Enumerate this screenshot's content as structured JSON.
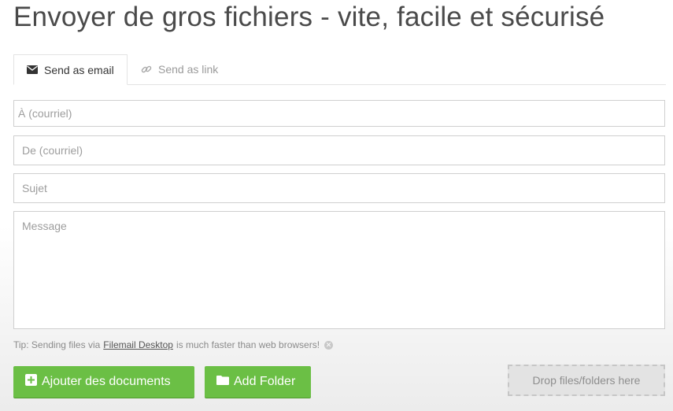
{
  "header": {
    "title": "Envoyer de gros fichiers - vite, facile et sécurisé"
  },
  "tabs": [
    {
      "label": "Send as email",
      "icon": "envelope-icon",
      "active": true
    },
    {
      "label": "Send as link",
      "icon": "link-icon",
      "active": false
    }
  ],
  "form": {
    "to_placeholder": "À (courriel)",
    "from_placeholder": "De (courriel)",
    "subject_placeholder": "Sujet",
    "message_placeholder": "Message"
  },
  "tip": {
    "prefix": "Tip: Sending files via",
    "link": "Filemail Desktop",
    "suffix": "is much faster than web browsers!"
  },
  "actions": {
    "add_documents_label": "Ajouter des documents",
    "add_folder_label": "Add Folder",
    "drop_zone_label": "Drop files/folders here"
  },
  "colors": {
    "accent": "#6bbf45",
    "border": "#cfcfcf",
    "title": "#4a4a4a"
  }
}
